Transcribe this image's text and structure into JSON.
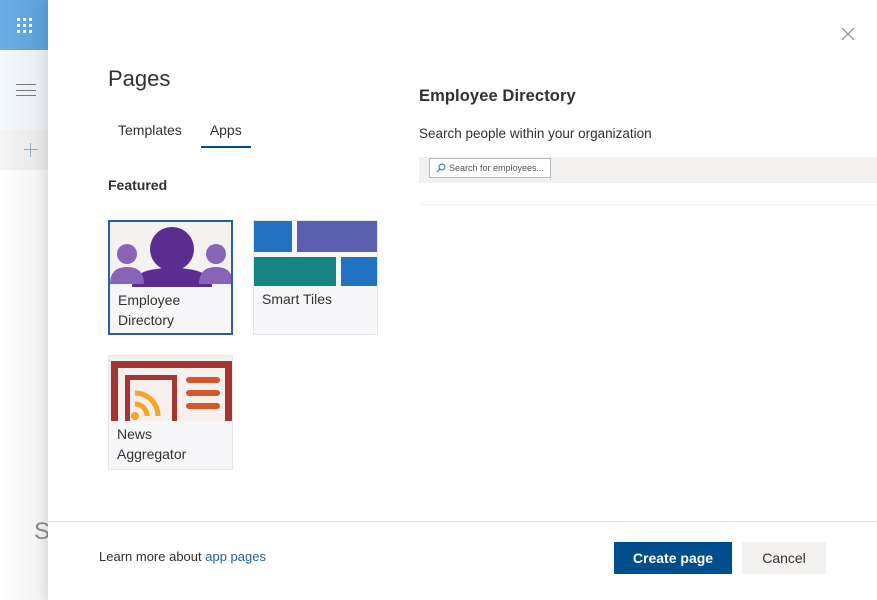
{
  "background_app": {
    "rail": {
      "app_launcher_icon": "waffle-icon",
      "nav_toggle_icon": "hamburger-icon",
      "add_icon": "plus-icon",
      "site_letter": "S"
    }
  },
  "panel": {
    "title": "Pages",
    "close_icon": "close-icon",
    "tabs": [
      {
        "label": "Templates",
        "active": false
      },
      {
        "label": "Apps",
        "active": true
      }
    ],
    "section_label": "Featured",
    "cards": [
      {
        "label": "Employee Directory",
        "selected": true,
        "thumbnail": "people-group-icon",
        "thumb_color": "#5c2d91"
      },
      {
        "label": "Smart Tiles",
        "selected": false,
        "thumbnail": "tiles-icon",
        "thumb_colors": [
          "#2272c2",
          "#5a5fb0",
          "#148580",
          "#2272c2"
        ]
      },
      {
        "label": "News Aggregator",
        "selected": false,
        "thumbnail": "rss-news-icon",
        "thumb_colors": [
          "#a43532",
          "#f7a229",
          "#d0582a"
        ]
      }
    ],
    "preview": {
      "title": "Employee Directory",
      "subtitle": "Search people within your organization",
      "search_placeholder": "Search for employees...",
      "search_icon": "search-icon"
    },
    "footer": {
      "learn_more_prefix": "Learn more about ",
      "learn_more_link": "app pages",
      "primary_button": "Create page",
      "secondary_button": "Cancel"
    }
  },
  "colors": {
    "primary": "#004e8c",
    "link": "#1f5f9a",
    "selected_border": "#2b5fa0",
    "launcher": "#62a8e2"
  }
}
